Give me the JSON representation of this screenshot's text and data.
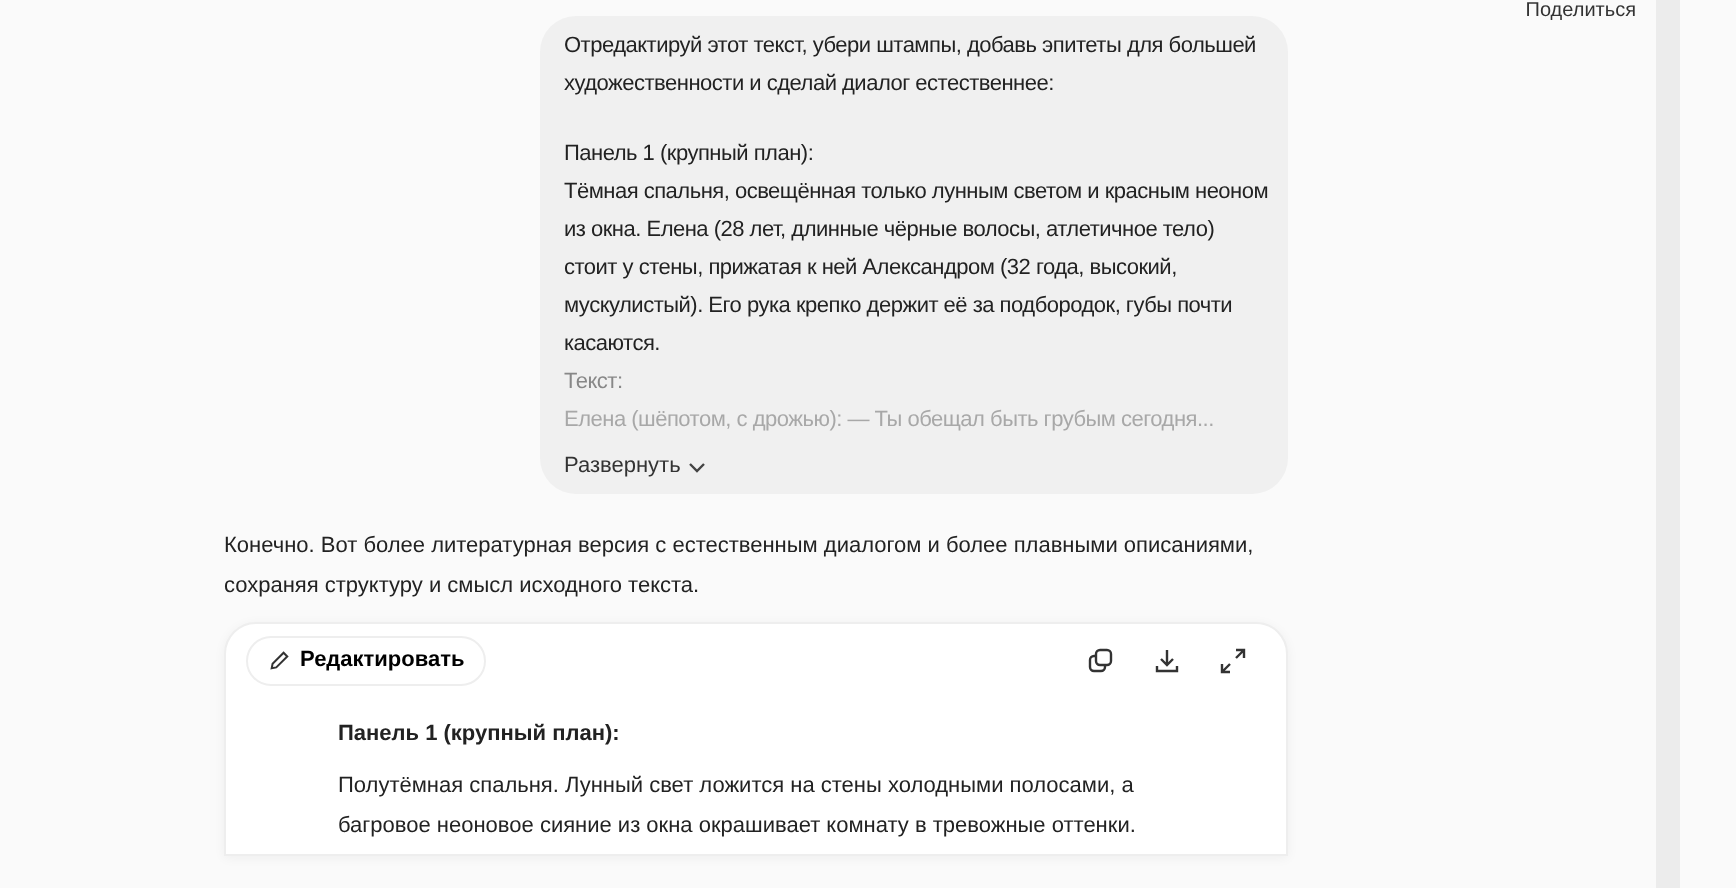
{
  "share": {
    "label": "Поделиться"
  },
  "user_message": {
    "intro": "Отредактируй этот текст, убери штампы, добавь эпитеты для большей художественности и сделай диалог естественнее:",
    "body": [
      {
        "kind": "normal",
        "text": "Панель 1 (крупный план):"
      },
      {
        "kind": "normal",
        "text": "Тёмная спальня, освещённая только лунным светом и красным неоном из окна. Елена (28 лет, длинные чёрные волосы, атлетичное тело) стоит у стены, прижатая к ней Александром (32 года, высокий, мускулистый). Его рука крепко держит её за подбородок, губы почти касаются."
      },
      {
        "kind": "dim",
        "text": "Текст:"
      },
      {
        "kind": "faded",
        "text": "Елена (шёпотом, с дрожью): — Ты обещал быть грубым сегодня..."
      }
    ],
    "expand_label": "Развернуть"
  },
  "assistant_message": {
    "text": "Конечно. Вот более литературная версия с естественным диалогом и более плавными описаниями, сохраняя структуру и смысл исходного текста."
  },
  "document": {
    "edit_label": "Редактировать",
    "heading": "Панель 1 (крупный план):",
    "paragraph": "Полутёмная спальня. Лунный свет ложится на стены холодными полосами, а багровое неоновое сияние из окна окрашивает комнату в тревожные оттенки."
  }
}
